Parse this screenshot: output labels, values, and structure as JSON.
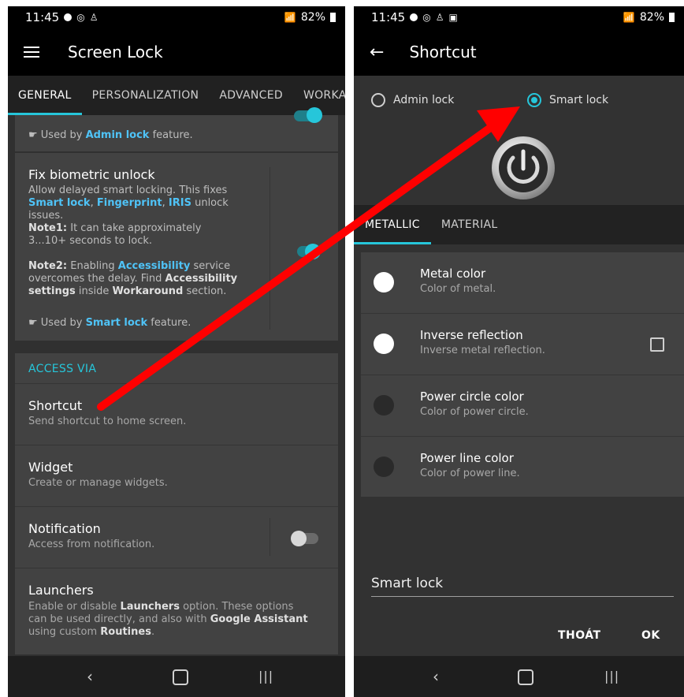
{
  "left": {
    "status": {
      "time": "11:45",
      "battery": "82%"
    },
    "appbar": {
      "title": "Screen Lock"
    },
    "tabs": [
      "GENERAL",
      "PERSONALIZATION",
      "ADVANCED",
      "WORKAROUND"
    ],
    "top_card": {
      "used_by_prefix": "Used by",
      "used_by_feature": "Admin lock",
      "used_by_suffix": "feature."
    },
    "fix_biometric": {
      "title": "Fix biometric unlock",
      "desc1": "Allow delayed smart locking. This fixes",
      "desc_smart": "Smart lock",
      "desc_sep1": ",",
      "desc_fp": "Fingerprint",
      "desc_iris": "IRIS",
      "desc2": "unlock issues.",
      "note1_label": "Note1:",
      "note1_text": "It can take approximately 3...10+ seconds to lock.",
      "note2_label": "Note2:",
      "note2_a": "Enabling",
      "note2_acc": "Accessibility",
      "note2_b": "service overcomes the delay. Find",
      "note2_acc2": "Accessibility settings",
      "note2_c": "inside",
      "note2_work": "Workaround",
      "note2_d": "section.",
      "used_by_prefix": "Used by",
      "used_by_feature": "Smart lock",
      "used_by_suffix": "feature."
    },
    "access": {
      "header": "ACCESS VIA",
      "items": [
        {
          "title": "Shortcut",
          "subtitle": "Send shortcut to home screen."
        },
        {
          "title": "Widget",
          "subtitle": "Create or manage widgets."
        },
        {
          "title": "Notification",
          "subtitle": "Access from notification."
        },
        {
          "title": "Launchers"
        }
      ],
      "launchers_a": "Enable or disable",
      "launchers_b": "Launchers",
      "launchers_c": "option. These options can be used directly, and also with",
      "launchers_d": "Google Assistant",
      "launchers_e": "using custom",
      "launchers_f": "Routines",
      "launchers_g": "."
    }
  },
  "right": {
    "status": {
      "time": "11:45",
      "battery": "82%"
    },
    "appbar": {
      "title": "Shortcut"
    },
    "lock_options": [
      "Admin lock",
      "Smart lock"
    ],
    "selected_option": "Smart lock",
    "tabs": [
      "METALLIC",
      "MATERIAL"
    ],
    "settings": [
      {
        "title": "Metal color",
        "subtitle": "Color of metal.",
        "color": "#ffffff"
      },
      {
        "title": "Inverse reflection",
        "subtitle": "Inverse metal reflection.",
        "color": "#ffffff"
      },
      {
        "title": "Power circle color",
        "subtitle": "Color of power circle.",
        "color": "#2a2a2a"
      },
      {
        "title": "Power line color",
        "subtitle": "Color of power line.",
        "color": "#2a2a2a"
      }
    ],
    "name_value": "Smart lock",
    "buttons": {
      "cancel": "THOÁT",
      "ok": "OK"
    }
  },
  "colors": {
    "accent": "#26c6da",
    "arrow": "#ff0000"
  }
}
